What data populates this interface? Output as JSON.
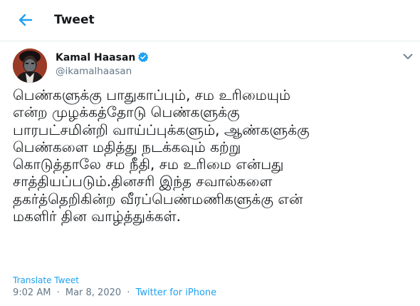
{
  "colors": {
    "accent": "#1da1f2",
    "text": "#14171a",
    "secondary": "#657786",
    "verified": "#1da1f2"
  },
  "header": {
    "back_icon": "arrow-left-icon",
    "title": "Tweet"
  },
  "author": {
    "name": "Kamal Haasan",
    "verified_icon": "verified-badge-icon",
    "handle": "@ikamalhaasan",
    "more_icon": "chevron-down-icon"
  },
  "tweet": {
    "lines": [
      "பெண்களுக்கு பாதுகாப்பும், சம உரிமையும்",
      "என்ற முழக்கத்தோடு பெண்களுக்கு",
      "பாரபட்சமின்றி வாய்ப்புக்களும், ஆண்களுக்கு",
      "பெண்களை மதித்து நடக்கவும் கற்று",
      "கொடுத்தாலே சம நீதி, சம உரிமை என்பது",
      "சாத்தியப்படும்.தினசரி இந்த சவால்களை",
      "தகர்த்தெறிகின்ற வீரப்பெண்மணிகளுக்கு என்",
      "மகளிர் தின வாழ்த்துக்கள்."
    ],
    "translate_label": "Translate Tweet",
    "time": "9:02 AM",
    "separator": "·",
    "date": "Mar 8, 2020",
    "source": "Twitter for iPhone"
  }
}
